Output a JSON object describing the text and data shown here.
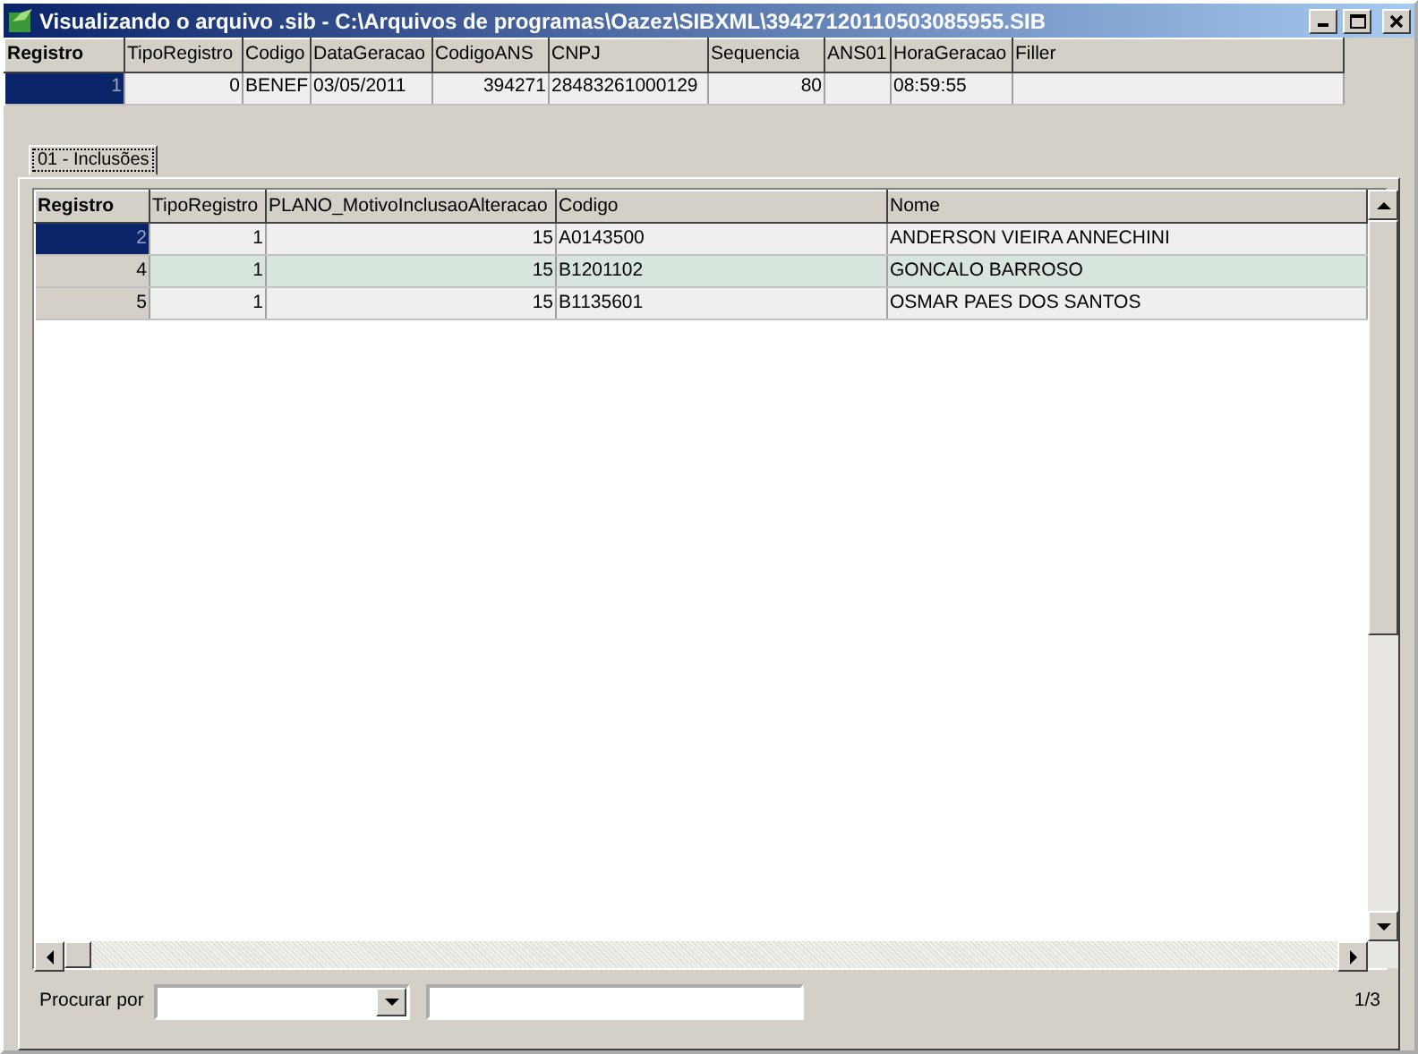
{
  "window": {
    "title": "Visualizando o arquivo .sib - C:\\Arquivos de programas\\Oazez\\SIBXML\\39427120110503085955.SIB"
  },
  "header_grid": {
    "columns": [
      {
        "label": "Registro",
        "key": true
      },
      {
        "label": "TipoRegistro",
        "numeric": true
      },
      {
        "label": "Codigo"
      },
      {
        "label": "DataGeracao"
      },
      {
        "label": "CodigoANS",
        "numeric": true
      },
      {
        "label": "CNPJ"
      },
      {
        "label": "Sequencia",
        "numeric": true
      },
      {
        "label": "ANS01"
      },
      {
        "label": "HoraGeracao"
      },
      {
        "label": "Filler"
      }
    ],
    "rows": [
      {
        "current": true,
        "cells": [
          "1",
          "0",
          "BENEF",
          "03/05/2011",
          "394271",
          "28483261000129",
          "80",
          "",
          "08:59:55",
          ""
        ]
      }
    ]
  },
  "tabs": [
    {
      "label": "01 - Inclusões",
      "selected": true
    }
  ],
  "detail_grid": {
    "columns": [
      {
        "label": "Registro",
        "key": true
      },
      {
        "label": "TipoRegistro",
        "numeric": true
      },
      {
        "label": "PLANO_MotivoInclusaoAlteracao",
        "numeric": true
      },
      {
        "label": "Codigo"
      },
      {
        "label": "Nome"
      }
    ],
    "rows": [
      {
        "current": true,
        "cells": [
          "2",
          "1",
          "15",
          "A0143500",
          "ANDERSON VIEIRA ANNECHINI"
        ]
      },
      {
        "current": false,
        "cells": [
          "4",
          "1",
          "15",
          "B1201102",
          "GONCALO BARROSO"
        ]
      },
      {
        "current": false,
        "cells": [
          "5",
          "1",
          "15",
          "B1135601",
          "OSMAR PAES DOS SANTOS"
        ]
      }
    ]
  },
  "search": {
    "label": "Procurar por",
    "count": "1/3"
  }
}
